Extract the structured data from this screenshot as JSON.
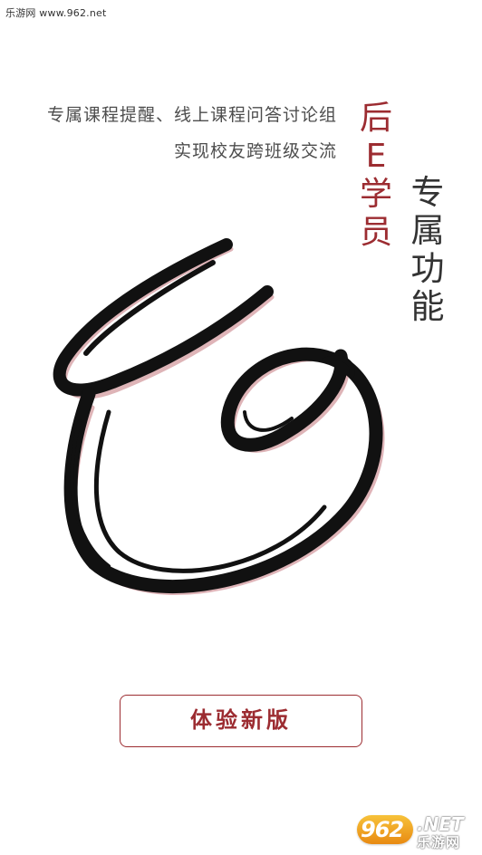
{
  "watermark_top": "乐游网 www.962.net",
  "taglines": [
    "专属课程提醒、线上课程问答讨论组",
    "实现校友跨班级交流"
  ],
  "vertical_red": [
    "后",
    "E",
    "学",
    "员"
  ],
  "vertical_gray": [
    "专",
    "属",
    "功",
    "能"
  ],
  "cta_button_label": "体验新版",
  "watermark_bottom": {
    "badge": "962",
    "net": ".NET",
    "cn": "乐游网"
  },
  "colors": {
    "brand_red": "#9c2c31",
    "text_gray": "#4d4d4d",
    "ink_black": "#111111",
    "shadow_pink": "#d9a7ab"
  },
  "icons": {
    "logo": "calligraphy-e-logo-icon"
  }
}
